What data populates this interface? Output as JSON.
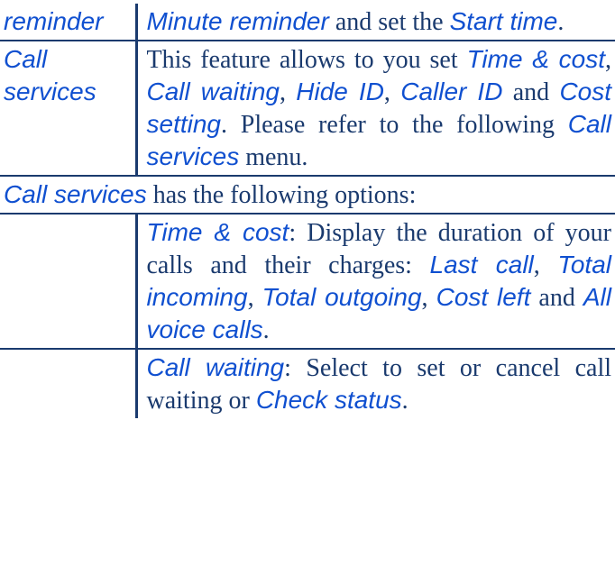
{
  "rows": {
    "reminder": {
      "label": "reminder",
      "desc_prefix": "",
      "t1": "Minute reminder",
      "mid1": " and set the ",
      "t2": "Start time",
      "suffix": "."
    },
    "call_services": {
      "label": "Call services",
      "p1": "This feature allows to you set ",
      "t1": "Time & cost",
      "c1": ", ",
      "t2": "Call waiting",
      "c2": ", ",
      "t3": "Hide ID",
      "c3": ", ",
      "t4": "Caller ID",
      "mid": " and ",
      "t5": "Cost setting",
      "p2": ". Please refer to the following ",
      "t6": "Call services",
      "p3": " menu."
    },
    "section": {
      "t1": "Call services",
      "tail": " has the following options:"
    },
    "time_cost": {
      "t1": "Time & cost",
      "p1": ": Display the duration of your calls and their charges: ",
      "t2": "Last call",
      "c1": ", ",
      "t3": "Total incoming",
      "c2": ", ",
      "t4": "Total outgoing",
      "c3": ", ",
      "t5": "Cost left",
      "mid": " and ",
      "t6": "All voice calls",
      "suffix": "."
    },
    "call_waiting": {
      "t1": "Call waiting",
      "p1": ": Select to set or cancel call waiting or ",
      "t2": "Check status",
      "suffix": "."
    }
  }
}
